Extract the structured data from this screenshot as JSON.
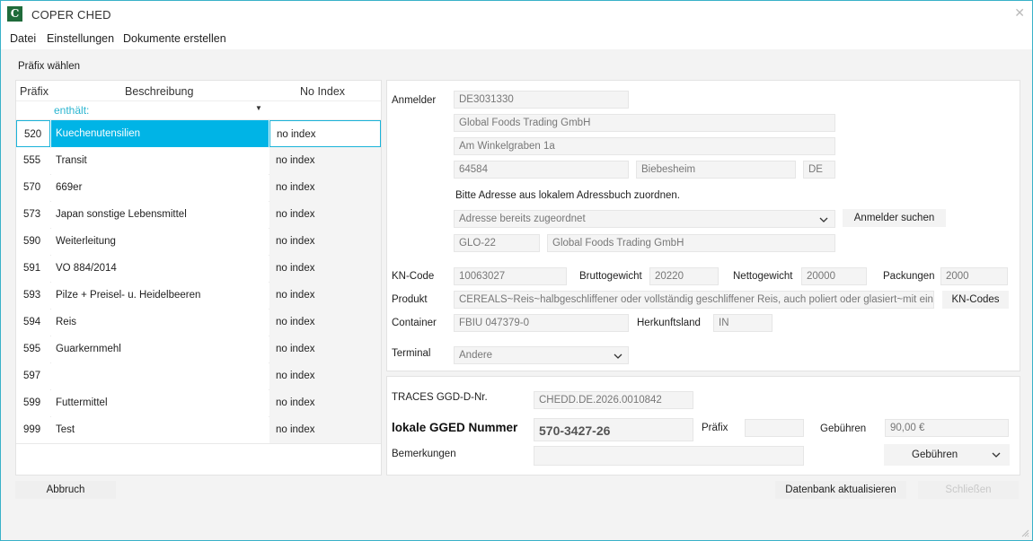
{
  "window": {
    "title": "COPER CHED",
    "app_icon": "C"
  },
  "menu": {
    "datei": "Datei",
    "einstellungen": "Einstellungen",
    "dokumente": "Dokumente erstellen"
  },
  "prefix_label": "Präfix wählen",
  "table": {
    "headers": {
      "prefix": "Präfix",
      "description": "Beschreibung",
      "index": "No Index"
    },
    "filter_text": "enthält:",
    "rows": [
      {
        "prefix": "520",
        "desc": "Kuechenutensilien",
        "index": "no index"
      },
      {
        "prefix": "555",
        "desc": "Transit",
        "index": "no index"
      },
      {
        "prefix": "570",
        "desc": "669er",
        "index": "no index"
      },
      {
        "prefix": "573",
        "desc": "Japan sonstige Lebensmittel",
        "index": "no index"
      },
      {
        "prefix": "590",
        "desc": "Weiterleitung",
        "index": "no index"
      },
      {
        "prefix": "591",
        "desc": "VO 884/2014",
        "index": "no index"
      },
      {
        "prefix": "593",
        "desc": "Pilze + Preisel- u. Heidelbeeren",
        "index": "no index"
      },
      {
        "prefix": "594",
        "desc": "Reis",
        "index": "no index"
      },
      {
        "prefix": "595",
        "desc": "Guarkernmehl",
        "index": "no index"
      },
      {
        "prefix": "597",
        "desc": "",
        "index": "no index"
      },
      {
        "prefix": "599",
        "desc": "Futtermittel",
        "index": "no index"
      },
      {
        "prefix": "999",
        "desc": "Test",
        "index": "no index"
      }
    ]
  },
  "anmelder": {
    "label": "Anmelder",
    "id": "DE3031330",
    "name": "Global Foods Trading GmbH",
    "street": "Am Winkelgraben 1a",
    "zip": "64584",
    "city": "Biebesheim",
    "country": "DE",
    "hint": "Bitte Adresse aus lokalem Adressbuch zuordnen.",
    "address_select": "Adresse bereits zugeordnet",
    "search_button": "Anmelder suchen",
    "short_code": "GLO-22",
    "short_name": "Global Foods Trading GmbH"
  },
  "goods": {
    "kn_code_label": "KN-Code",
    "kn_code": "10063027",
    "brutto_label": "Bruttogewicht",
    "brutto": "20220",
    "netto_label": "Nettogewicht",
    "netto": "20000",
    "pack_label": "Packungen",
    "pack": "2000",
    "produkt_label": "Produkt",
    "produkt": "CEREALS~Reis~halbgeschliffener oder vollständig geschliffener Reis, auch poliert oder glasiert~mit ein",
    "kn_button": "KN-Codes",
    "container_label": "Container",
    "container": "FBIU 047379-0",
    "herkunft_label": "Herkunftsland",
    "herkunft": "IN",
    "terminal_label": "Terminal",
    "terminal": "Andere"
  },
  "traces": {
    "label": "TRACES GGD-D-Nr.",
    "value": "CHEDD.DE.2026.0010842",
    "gged_label": "lokale GGED Nummer",
    "gged": "570-3427-26",
    "praefix_label": "Präfix",
    "praefix": "",
    "gebuehren_label": "Gebühren",
    "gebuehren": "90,00 €",
    "bemerk_label": "Bemerkungen",
    "bemerk": "",
    "gebuehren_button": "Gebühren"
  },
  "footer": {
    "abbruch": "Abbruch",
    "db_update": "Datenbank aktualisieren",
    "schliessen": "Schließen"
  },
  "colors": {
    "accent": "#00b4e6",
    "window_border": "#39b1c8",
    "filter_text": "#2ab5d0"
  }
}
